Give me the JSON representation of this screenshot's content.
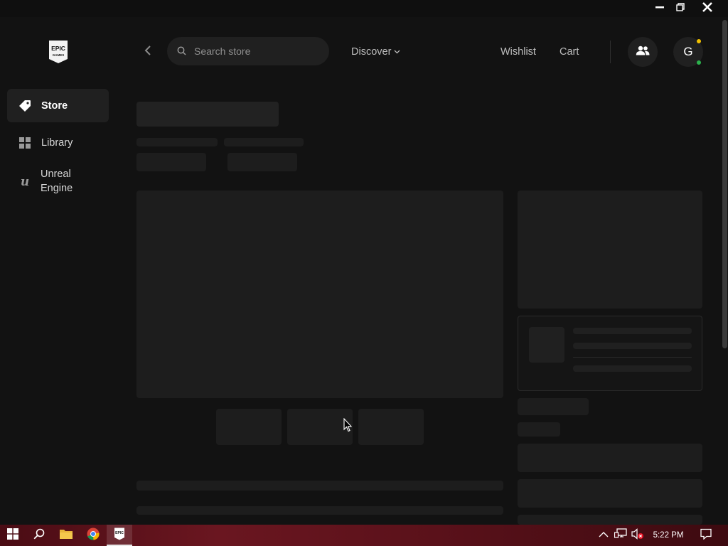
{
  "window": {
    "controls": {
      "minimize": "minimize-icon",
      "maximize": "restore-icon",
      "close": "close-icon"
    }
  },
  "sidebar": {
    "logo_text": "EPIC GAMES",
    "items": [
      {
        "label": "Store",
        "icon": "tag-icon",
        "active": true
      },
      {
        "label": "Library",
        "icon": "grid-icon",
        "active": false
      },
      {
        "label": "Unreal Engine",
        "icon": "unreal-icon",
        "active": false
      }
    ]
  },
  "header": {
    "search": {
      "placeholder": "Search store",
      "value": ""
    },
    "discover_label": "Discover",
    "wishlist_label": "Wishlist",
    "cart_label": "Cart",
    "avatar_initial": "G",
    "status_colors": {
      "notification": "#f2c100",
      "online": "#2bb24c"
    }
  },
  "taskbar": {
    "apps": [
      "windows-start-icon",
      "search-icon",
      "file-explorer-icon",
      "chrome-icon",
      "epic-games-icon"
    ],
    "time": "5:22 PM"
  }
}
